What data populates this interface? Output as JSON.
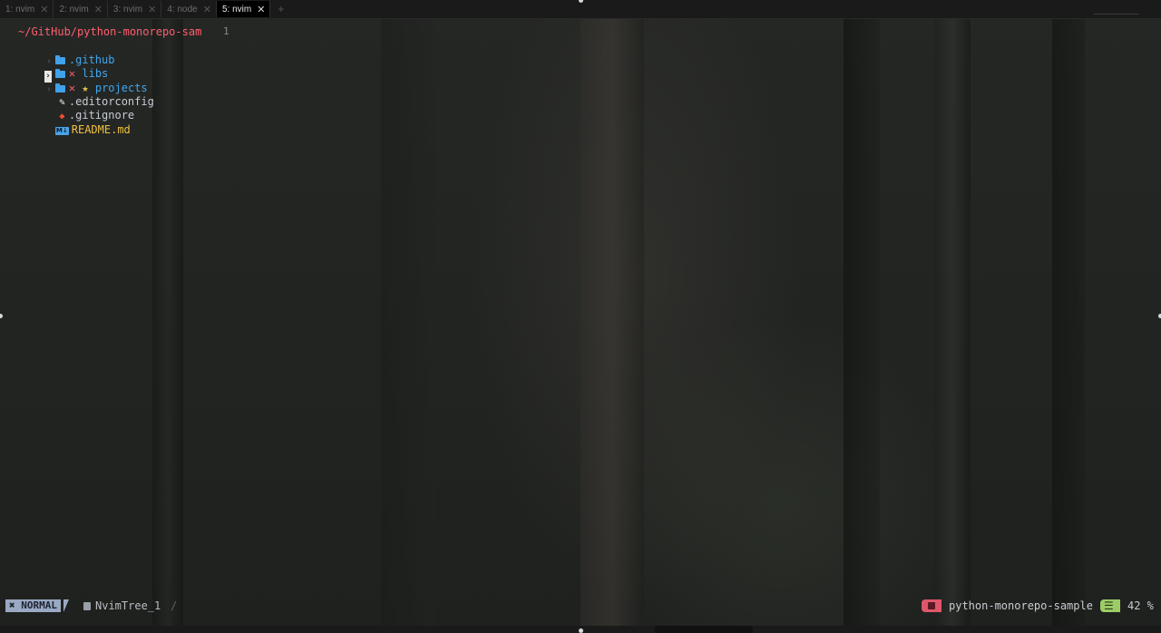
{
  "tabs": [
    {
      "label": "1: nvim",
      "active": false
    },
    {
      "label": "2: nvim",
      "active": false
    },
    {
      "label": "3: nvim",
      "active": false
    },
    {
      "label": "4: node",
      "active": false
    },
    {
      "label": "5: nvim",
      "active": true
    }
  ],
  "tab_add_label": "+",
  "tree": {
    "root": "~/GitHub/python-monorepo-sam",
    "line_number": "1",
    "items": [
      {
        "name": ".github",
        "kind": "folder",
        "icon": "folder-icon"
      },
      {
        "name": "libs",
        "kind": "folder",
        "icon": "folder-icon",
        "status": "✕"
      },
      {
        "name": "projects",
        "kind": "folder",
        "icon": "folder-icon",
        "status": "✕",
        "bookmark": "★"
      },
      {
        "name": ".editorconfig",
        "kind": "file",
        "icon": "editorconfig-icon"
      },
      {
        "name": ".gitignore",
        "kind": "file",
        "icon": "git-icon"
      },
      {
        "name": "README.md",
        "kind": "file",
        "icon": "markdown-icon",
        "icon_text": "M↓"
      }
    ]
  },
  "statusline": {
    "mode": "NORMAL",
    "mode_icon": "✖",
    "buffer": "NvimTree_1",
    "buffer_sep": "/",
    "project": "python-monorepo-sample",
    "percent": "42 %"
  },
  "colors": {
    "root": "#ff5f6d",
    "folder": "#41a6ec",
    "mode_bg": "#9aa9c3",
    "project_accent": "#e0566b",
    "percent_accent": "#9ccc65"
  }
}
